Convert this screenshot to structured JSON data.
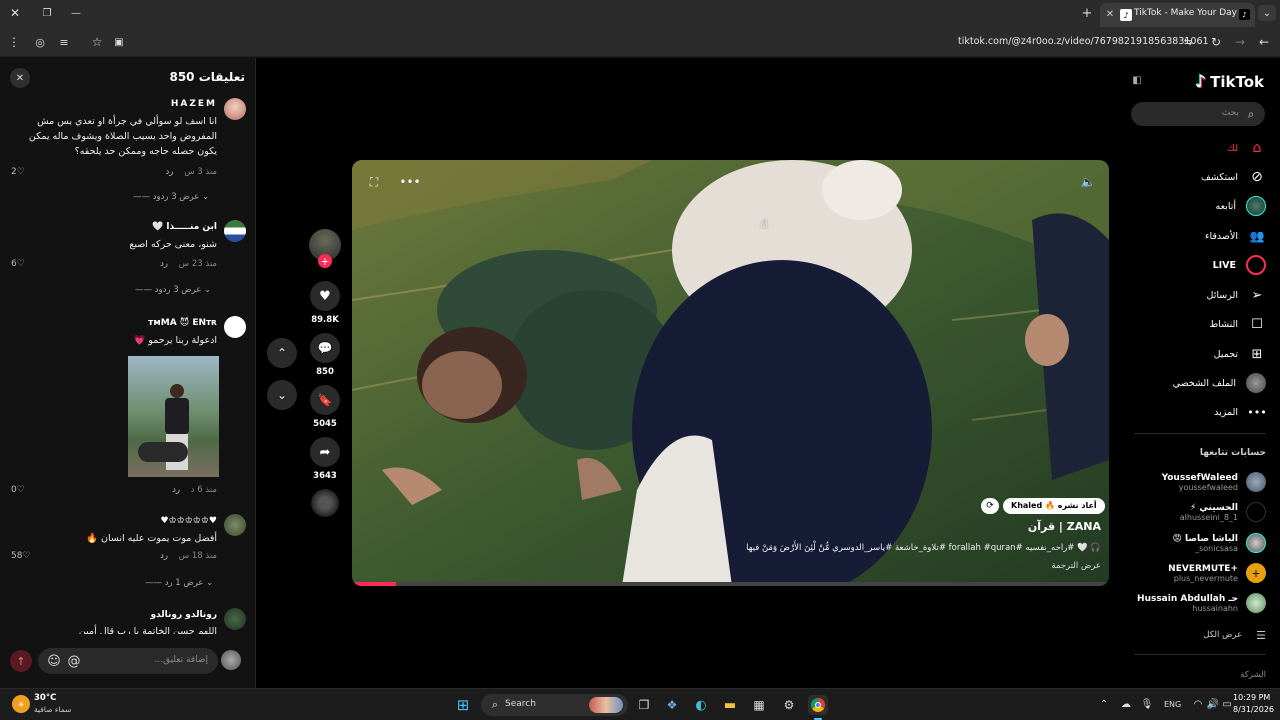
{
  "browser": {
    "tab_title": "TikTok - Make Your Day",
    "url": "tiktok.com/@z4r0oo.z/video/7679821918563831061"
  },
  "comments": {
    "title": "تعليقات 850",
    "items": [
      {
        "author": "HAZEM",
        "text": "انا اسف لو سوألي في جرأة او تعدي بس مش المفروض واحد يسيب الصلاة ويشوف ماله يمكن يكون حصله حاجه وممكن حد يلحقه؟",
        "time": "منذ 3 س",
        "reply": "رد",
        "likes": "2",
        "replies": "عرض 3 ردود"
      },
      {
        "author": "ابن منـــــذا 🤍",
        "text": "شنو، معنى حركه اصبع",
        "time": "منذ 23 س",
        "reply": "رد",
        "likes": "6",
        "replies": "عرض 3 ردود"
      },
      {
        "author": "ᴛᴍMA 😈 ENᴛʀ",
        "text": "ادعولة ربنا يرحمو 💗",
        "time": "منذ 6 د",
        "reply": "رد",
        "likes": "0"
      },
      {
        "author": "♥♔♔♔♔♔♥",
        "text": "أفضل موت يموت عليه انسان 🔥",
        "time": "منذ 18 س",
        "reply": "رد",
        "likes": "58",
        "replies": "عرض 1 رد"
      },
      {
        "author": "رونالدو رونالدو",
        "text": "اللهم حسن الخاتمة يا رب قال أمين"
      }
    ],
    "input_placeholder": "إضافة تعليق..."
  },
  "video": {
    "author_badge": "Khaled 🔥 أعاد نشره",
    "title": "ZANA | قرآن",
    "desc": "🎧 🤍 #راحه_نفسيه #forallah #quran #تلاوة_خاشعة #ياسر_الدوسري مُّنْ لْئِنَ الأَرْضَ وَمَنْ فيها",
    "translate": "عرض الترجمة",
    "likes": "89.8K",
    "comments": "850",
    "saves": "5045",
    "shares": "3643"
  },
  "sidebar": {
    "logo": "TikTok",
    "search_placeholder": "بحث",
    "nav": [
      {
        "label": "لك",
        "icon": "home-icon"
      },
      {
        "label": "استكشف",
        "icon": "compass-icon"
      },
      {
        "label": "أتابعه",
        "icon": "following-icon"
      },
      {
        "label": "الأصدقاء",
        "icon": "friends-icon"
      },
      {
        "label": "LIVE",
        "icon": "live-icon"
      },
      {
        "label": "الرسائل",
        "icon": "messages-icon"
      },
      {
        "label": "النشاط",
        "icon": "activity-icon"
      },
      {
        "label": "تحميل",
        "icon": "upload-icon"
      },
      {
        "label": "الملف الشخصي",
        "icon": "profile-icon"
      },
      {
        "label": "المزيد",
        "icon": "more-icon"
      }
    ],
    "following_title": "حسابات تتابعها",
    "following": [
      {
        "name": "YoussefWaleed",
        "user": "youssefwaleed"
      },
      {
        "name": "الحسيني ⚡",
        "user": "alhusseini_8_1"
      },
      {
        "name": "الباشا صاصا 😡",
        "user": "_sonicsasa"
      },
      {
        "name": "NEVERMUTE+",
        "user": "plus_nevermute"
      },
      {
        "name": "Hussain Abdullah حـ",
        "user": "hussainahn"
      }
    ],
    "see_all": "عرض الكل",
    "company": "الشركة"
  },
  "taskbar": {
    "temp": "30°C",
    "weather": "سماء صافية",
    "search": "Search",
    "lang": "ENG",
    "time": "10:29 PM",
    "date": "8/31/2026"
  }
}
